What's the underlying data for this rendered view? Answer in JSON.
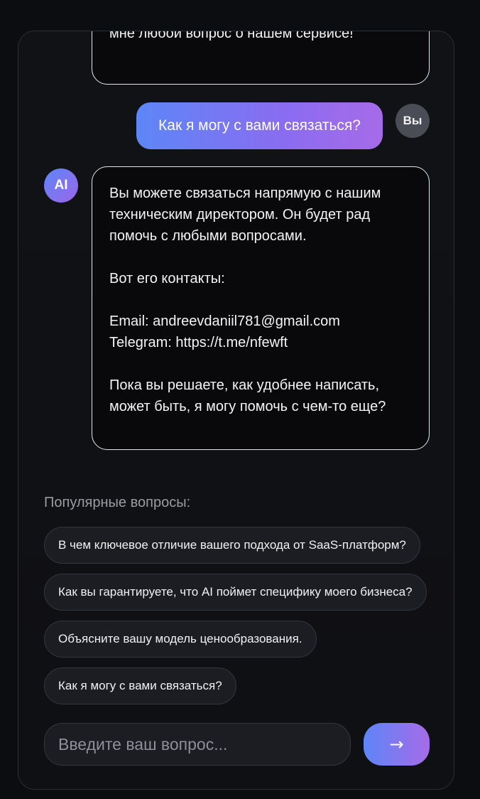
{
  "chat": {
    "prev_bot_message_tail": "мне любой вопрос о нашем сервисе!",
    "user_message": "Как я могу с вами связаться?",
    "user_avatar_label": "Вы",
    "ai_avatar_label": "AI",
    "bot_reply": "Вы можете связаться напрямую с нашим техническим директором. Он будет рад помочь с любыми вопросами.\n\nВот его контакты:\n\nEmail: andreevdaniil781@gmail.com\nTelegram: https://t.me/nfewft\n\nПока вы решаете, как удобнее написать, может быть, я могу помочь с чем-то еще?"
  },
  "popular": {
    "title": "Популярные вопросы:",
    "questions": [
      "В чем ключевое отличие вашего подхода от SaaS-платформ?",
      "Как вы гарантируете, что AI поймет специфику моего бизнеса?",
      "Объясните вашу модель ценообразования.",
      "Как я могу с вами связаться?"
    ]
  },
  "composer": {
    "placeholder": "Введите ваш вопрос...",
    "value": "",
    "send_label": "→"
  },
  "colors": {
    "accent_start": "#5d86f7",
    "accent_end": "#a66be8",
    "background": "#0c0d10"
  }
}
